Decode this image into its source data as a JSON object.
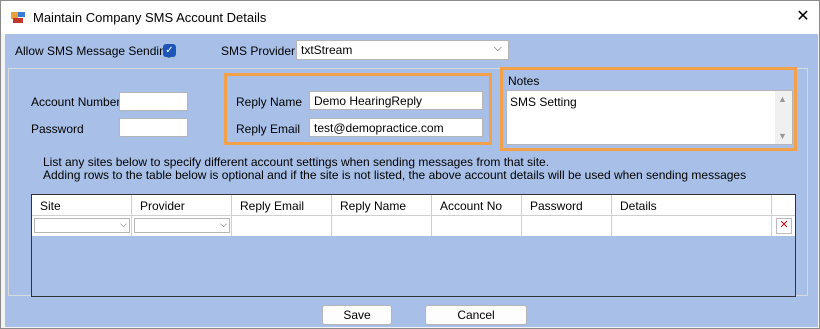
{
  "window": {
    "title": "Maintain Company SMS Account Details",
    "close_glyph": "✕"
  },
  "top": {
    "allow_sms_label": "Allow SMS Message Sending",
    "allow_sms_checked": true,
    "provider_label": "SMS Provider",
    "provider_value": "txtStream"
  },
  "account": {
    "number_label": "Account Number",
    "number_value": "",
    "password_label": "Password",
    "password_value": ""
  },
  "reply": {
    "name_label": "Reply Name",
    "name_value": "Demo HearingReply",
    "email_label": "Reply Email",
    "email_value": "test@demopractice.com"
  },
  "notes": {
    "label": "Notes",
    "value": "SMS Setting"
  },
  "info": {
    "line1": "List any sites below to specify different account settings when sending messages from that site.",
    "line2": "Adding rows to the table below is optional and if the site is not listed, the above account details will be used when sending messages"
  },
  "table": {
    "columns": [
      "Site",
      "Provider",
      "Reply Email",
      "Reply Name",
      "Account No",
      "Password",
      "Details"
    ],
    "rows": [
      [
        "",
        "",
        "",
        "",
        "",
        "",
        ""
      ]
    ]
  },
  "buttons": {
    "save": "Save",
    "cancel": "Cancel"
  },
  "colors": {
    "client_bg": "#a8c0e8",
    "highlight": "#f3a04a",
    "checkbox": "#1e56b7",
    "delete": "#cc1111"
  },
  "icons": {
    "app": "app-icon",
    "close": "close-icon",
    "dropdown": "chevron-down-icon",
    "delete": "delete-row-icon"
  }
}
